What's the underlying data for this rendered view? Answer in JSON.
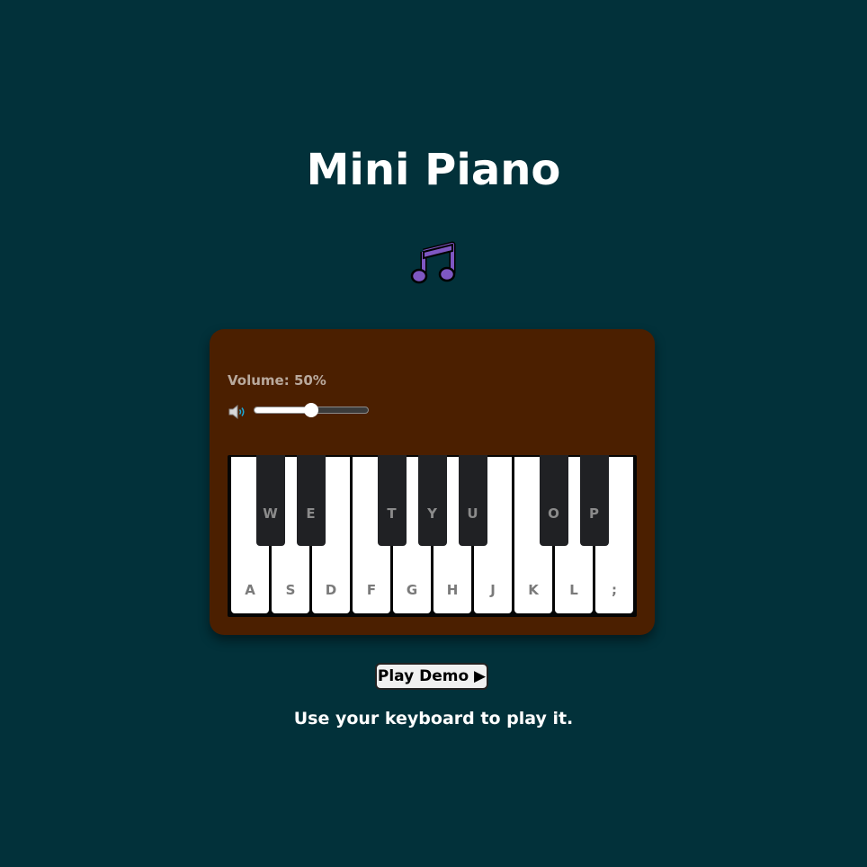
{
  "app": {
    "title": "Mini Piano",
    "icon": "music-note-icon"
  },
  "volume": {
    "label": "Volume: 50%",
    "value": 0.5,
    "icon": "speaker-icon"
  },
  "keyboard": {
    "white_keys": [
      "A",
      "S",
      "D",
      "F",
      "G",
      "H",
      "J",
      "K",
      "L",
      ";"
    ],
    "black_keys": [
      "W",
      "E",
      "T",
      "Y",
      "U",
      "O",
      "P"
    ]
  },
  "controls": {
    "demo_label": "Play Demo ▶"
  },
  "hint": "Use your keyboard to play it.",
  "colors": {
    "background": "#02313a",
    "panel": "#4b1f00",
    "note_icon": "#7e57c2"
  }
}
